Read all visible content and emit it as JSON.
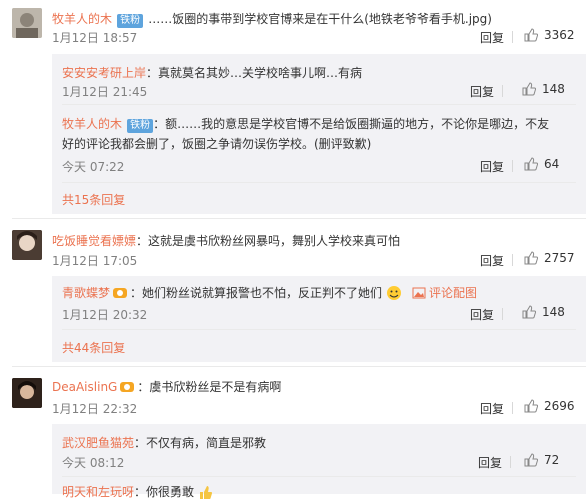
{
  "labels": {
    "reply": "回复",
    "colon": "：",
    "comment_pics": "评论配图"
  },
  "comments": [
    {
      "user": "牧羊人的木",
      "badge": "铁粉",
      "text": "……饭圈的事带到学校官博来是在干什么(地铁老爷爷看手机.jpg)",
      "time": "1月12日 18:57",
      "likes": "3362",
      "replies": [
        {
          "user": "安安安考研上岸",
          "text": "：真就莫名其妙…关学校啥事儿啊…有病",
          "time": "1月12日 21:45",
          "likes": "148"
        },
        {
          "user": "牧羊人的木",
          "badge": "铁粉",
          "text_line1": "：额……我的意思是学校官博不是给饭圈撕逼的地方，不论你是哪边，不友",
          "text_line2": "好的评论我都会删了，饭圈之争请勿误伤学校。(删评致歉)",
          "time": "今天 07:22",
          "likes": "64"
        }
      ],
      "more": "共15条回复"
    },
    {
      "user": "吃饭睡觉看嫖嫖",
      "text": "：这就是虞书欣粉丝网暴吗，舞别人学校来真可怕",
      "time": "1月12日 17:05",
      "likes": "2757",
      "replies": [
        {
          "user": "青歌蝶梦",
          "text": "：她们粉丝说就算报警也不怕，反正判不了她们",
          "time": "1月12日 20:32",
          "likes": "148"
        }
      ],
      "more": "共44条回复"
    },
    {
      "user": "DeaAislinG",
      "text": "：虞书欣粉丝是不是有病啊",
      "time": "1月12日 22:32",
      "likes": "2696",
      "replies": [
        {
          "user": "武汉肥鱼猫苑",
          "text": "：不仅有病，简直是邪教",
          "time": "今天 08:12",
          "likes": "72"
        },
        {
          "user": "明天和左玩呀",
          "text": "：你很勇敢"
        }
      ]
    }
  ],
  "colors": {
    "accent": "#eb7350",
    "badge": "#5ea4dd",
    "reply_bg": "#f2f2f5",
    "time": "#808080"
  },
  "icons": [
    "thumbs-up-icon",
    "emoji-icon",
    "image-icon",
    "fan-badge-icon"
  ]
}
